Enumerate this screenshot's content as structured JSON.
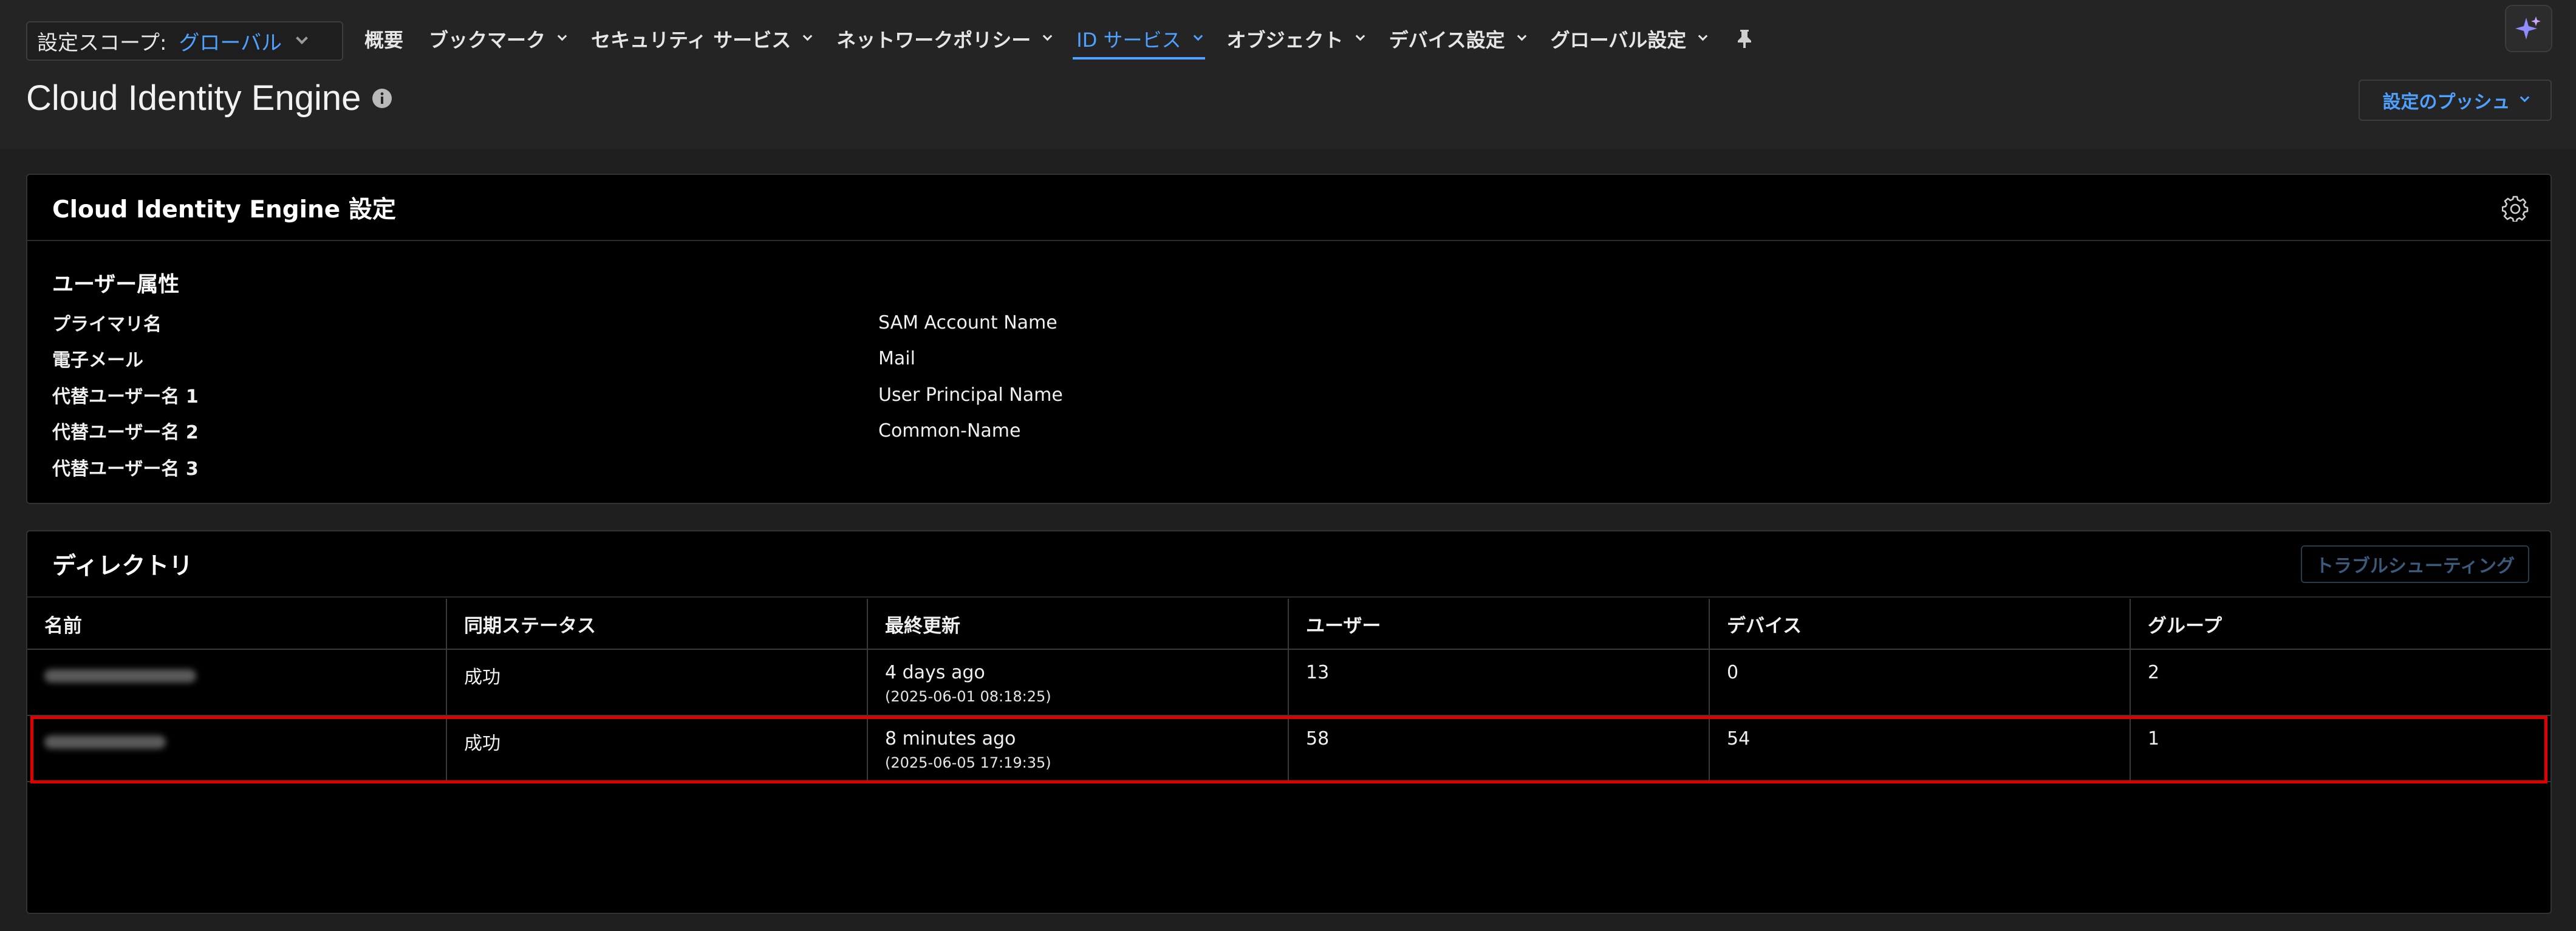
{
  "scope": {
    "label": "設定スコープ:",
    "value": "グローバル"
  },
  "nav": {
    "items": [
      {
        "label": "概要",
        "has_menu": false
      },
      {
        "label": "ブックマーク",
        "has_menu": true
      },
      {
        "label": "セキュリティ サービス",
        "has_menu": true
      },
      {
        "label": "ネットワークポリシー",
        "has_menu": true
      },
      {
        "label": "ID サービス",
        "has_menu": true,
        "active": true
      },
      {
        "label": "オブジェクト",
        "has_menu": true
      },
      {
        "label": "デバイス設定",
        "has_menu": true
      },
      {
        "label": "グローバル設定",
        "has_menu": true
      }
    ],
    "pin_icon": "pin-icon",
    "ai_icon": "sparkle-icon"
  },
  "page": {
    "title": "Cloud Identity Engine",
    "info_icon": "info-icon",
    "push_button": "設定のプッシュ"
  },
  "settings_panel": {
    "title": "Cloud Identity Engine 設定",
    "gear_icon": "gear-icon",
    "section_title": "ユーザー属性",
    "attributes": [
      {
        "key": "プライマリ名",
        "value": "SAM Account Name"
      },
      {
        "key": "電子メール",
        "value": "Mail"
      },
      {
        "key": "代替ユーザー名 1",
        "value": "User Principal Name"
      },
      {
        "key": "代替ユーザー名 2",
        "value": "Common-Name"
      },
      {
        "key": "代替ユーザー名 3",
        "value": ""
      }
    ]
  },
  "directory_panel": {
    "title": "ディレクトリ",
    "troubleshoot_button": "トラブルシューティング",
    "columns": [
      "名前",
      "同期ステータス",
      "最終更新",
      "ユーザー",
      "デバイス",
      "グループ"
    ],
    "rows": [
      {
        "name": "",
        "status": "成功",
        "updated": "4 days ago",
        "updated_ts": "(2025-06-01 08:18:25)",
        "users": "13",
        "devices": "0",
        "groups": "2"
      },
      {
        "name": "",
        "status": "成功",
        "updated": "8 minutes ago",
        "updated_ts": "(2025-06-05 17:19:35)",
        "users": "58",
        "devices": "54",
        "groups": "1",
        "highlighted": true
      }
    ]
  },
  "colors": {
    "accent": "#4ea1ff",
    "highlight_border": "#e00000",
    "panel_bg": "#000000",
    "page_bg": "#1f1f1f"
  }
}
